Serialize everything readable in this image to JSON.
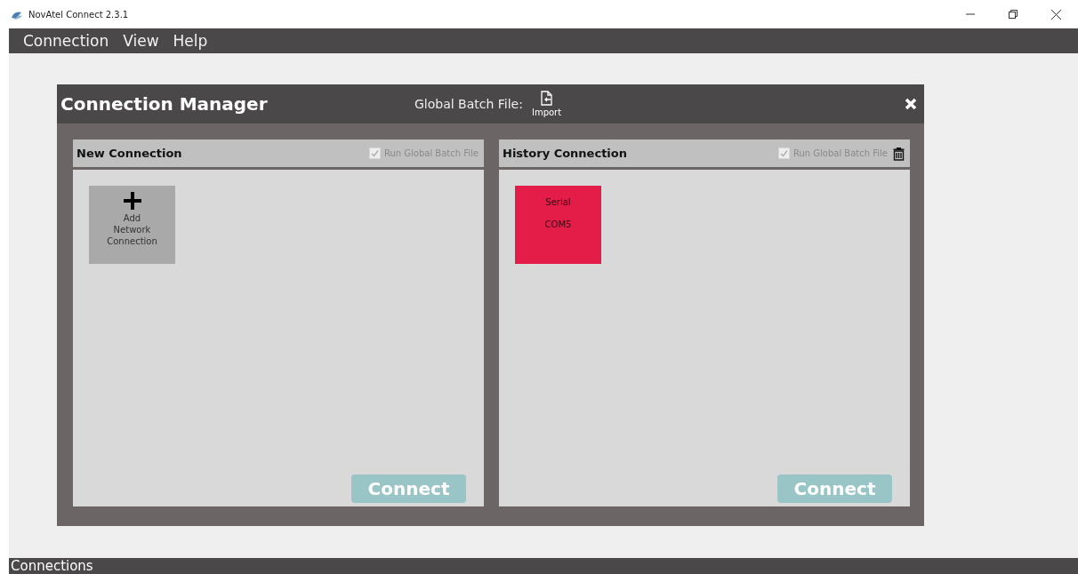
{
  "window": {
    "title": "NovAtel Connect 2.3.1"
  },
  "menu": [
    "Connection",
    "View",
    "Help"
  ],
  "dialog": {
    "title": "Connection Manager",
    "batch_label": "Global Batch File:",
    "import_label": "Import",
    "panels": [
      {
        "title": "New Connection",
        "run_batch": {
          "label": "Run Global Batch File",
          "checked": true
        },
        "trash": false,
        "tiles": [
          {
            "kind": "add",
            "lines": [
              "Add",
              "Network",
              "Connection"
            ]
          }
        ],
        "connect": {
          "label": "Connect",
          "disabled": true
        }
      },
      {
        "title": "History Connection",
        "run_batch": {
          "label": "Run Global Batch File",
          "checked": true
        },
        "trash": true,
        "tiles": [
          {
            "kind": "serial",
            "color": "#e31c48",
            "lines": [
              "Serial",
              "COM5"
            ]
          }
        ],
        "connect": {
          "label": "Connect",
          "disabled": true
        }
      }
    ]
  },
  "status_bar": {
    "title": "Connections"
  }
}
